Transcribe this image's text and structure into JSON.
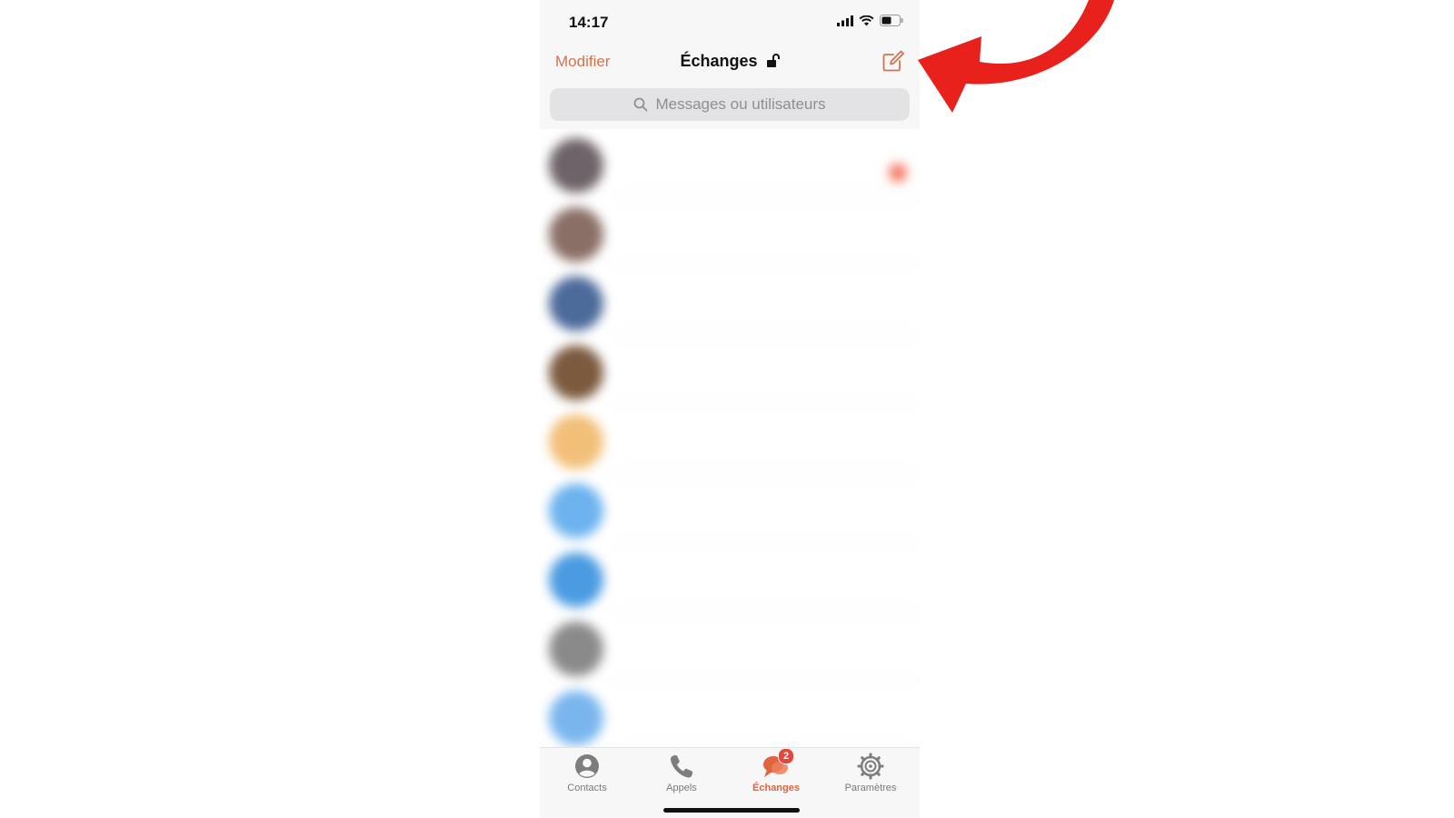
{
  "status_bar": {
    "time": "14:17",
    "signal_icon": "cellular-signal-icon",
    "wifi_icon": "wifi-icon",
    "battery_icon": "battery-icon"
  },
  "nav": {
    "edit_label": "Modifier",
    "title": "Échanges",
    "lock_icon": "unlocked-padlock-icon",
    "compose_icon": "compose-icon",
    "accent_color": "#d5734f"
  },
  "search": {
    "placeholder": "Messages ou utilisateurs",
    "icon": "search-icon"
  },
  "conversations": [
    {
      "avatar_color": "#6e6368",
      "name": "",
      "preview": "",
      "time": "",
      "unread": true
    },
    {
      "avatar_color": "#8a6f66",
      "name": "",
      "preview": "",
      "time": "",
      "unread": false
    },
    {
      "avatar_color": "#4c6a9a",
      "name": "",
      "preview": "",
      "time": "",
      "unread": false
    },
    {
      "avatar_color": "#7b5a3e",
      "name": "",
      "preview": "",
      "time": "",
      "unread": false
    },
    {
      "avatar_color": "#f2bf78",
      "name": "",
      "preview": "",
      "time": "",
      "unread": false
    },
    {
      "avatar_color": "#6cb3ef",
      "name": "",
      "preview": "",
      "time": "",
      "unread": false
    },
    {
      "avatar_color": "#4a9be2",
      "name": "",
      "preview": "",
      "time": "",
      "unread": false
    },
    {
      "avatar_color": "#8a8a8a",
      "name": "",
      "preview": "",
      "time": "",
      "unread": false
    },
    {
      "avatar_color": "#7ab6ee",
      "name": "",
      "preview": "",
      "time": "",
      "unread": false
    }
  ],
  "tabs": [
    {
      "label": "Contacts",
      "icon": "person-icon",
      "active": false
    },
    {
      "label": "Appels",
      "icon": "phone-icon",
      "active": false
    },
    {
      "label": "Échanges",
      "icon": "chat-bubbles-icon",
      "active": true,
      "badge": "2"
    },
    {
      "label": "Paramètres",
      "icon": "gear-icon",
      "active": false
    }
  ],
  "annotation": {
    "arrow_icon": "red-curved-arrow-icon",
    "arrow_color": "#e8211c"
  }
}
